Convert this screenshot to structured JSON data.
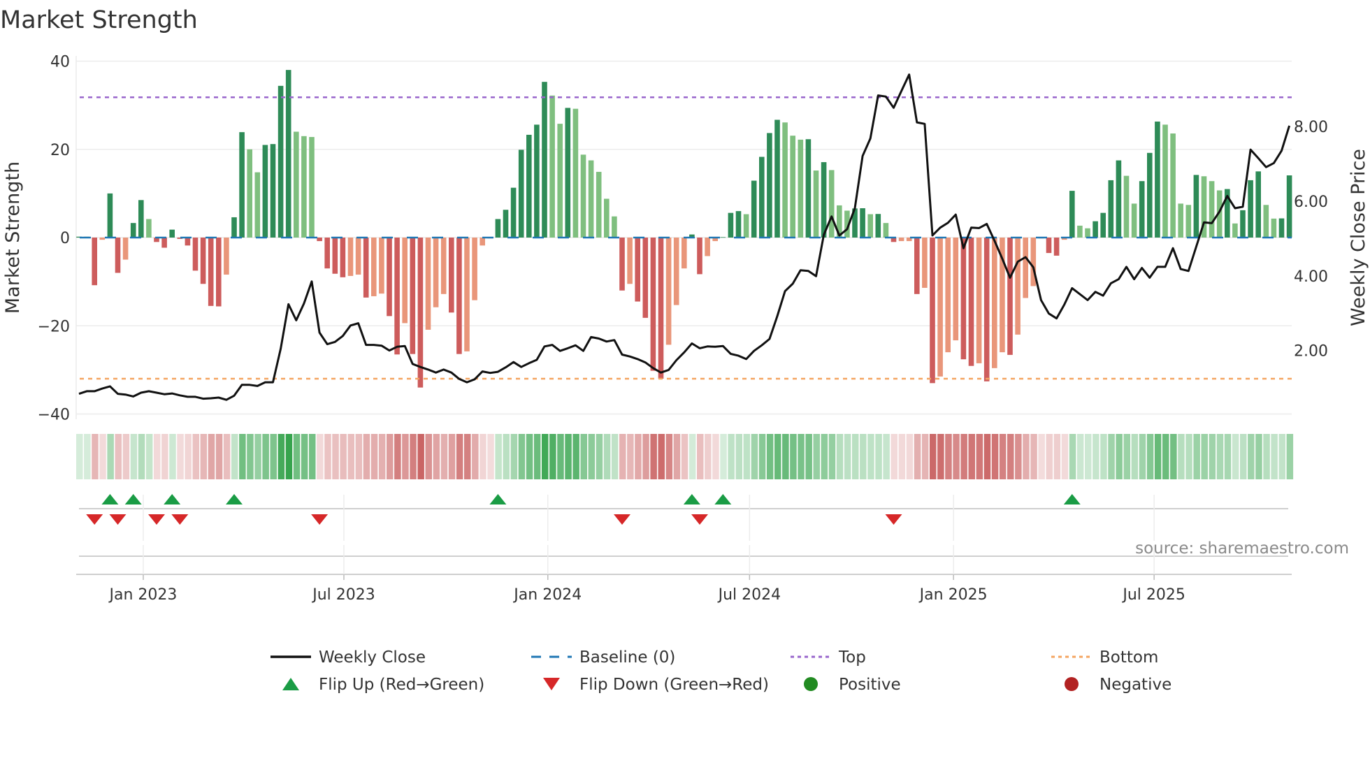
{
  "chart_data": {
    "type": "bar",
    "title": "Market Strength",
    "ylabel": "Market Strength",
    "y2label": "Weekly Close Price",
    "ylim": [
      -40,
      40
    ],
    "y2lim": [
      0.3,
      9.75
    ],
    "yticks": [
      "40",
      "20",
      "0",
      "−20",
      "−40"
    ],
    "ytick_values": [
      40,
      20,
      0,
      -20,
      -40
    ],
    "y2ticks": [
      "8.00",
      "6.00",
      "4.00",
      "2.00"
    ],
    "y2tick_values": [
      8,
      6,
      4,
      2
    ],
    "xticks": [
      {
        "label": "Jan 2023",
        "date": "2023-01-01"
      },
      {
        "label": "Jul 2023",
        "date": "2023-07-01"
      },
      {
        "label": "Jan 2024",
        "date": "2024-01-01"
      },
      {
        "label": "Jul 2024",
        "date": "2024-07-01"
      },
      {
        "label": "Jan 2025",
        "date": "2025-01-01"
      },
      {
        "label": "Jul 2025",
        "date": "2025-07-01"
      }
    ],
    "start_date": "2022-11-04",
    "frequency": "weekly",
    "top_level": 31.8,
    "bottom_level": -32,
    "baseline": 0,
    "strength": [
      0.2,
      0.2,
      -10.8,
      -0.5,
      10,
      -8,
      -5,
      3.3,
      8.5,
      4.2,
      -1,
      -2.3,
      1.8,
      -0.3,
      -1.8,
      -7.5,
      -10.5,
      -15.5,
      -15.6,
      -8.4,
      4.6,
      23.9,
      20,
      14.8,
      21,
      21.2,
      34.4,
      38,
      24,
      23,
      22.8,
      -0.8,
      -7,
      -8.2,
      -9,
      -8.7,
      -8.4,
      -13.6,
      -13.3,
      -12.7,
      -17.8,
      -26.5,
      -19.4,
      -26.4,
      -34,
      -20.9,
      -15.8,
      -12.8,
      -17,
      -26.4,
      -25.8,
      -14.2,
      -1.8,
      -0.2,
      4.2,
      6.3,
      11.3,
      19.9,
      23.3,
      25.6,
      35.3,
      32.2,
      25.8,
      29.4,
      29.2,
      18.8,
      17.5,
      14.9,
      8.8,
      4.8,
      -12,
      -10.5,
      -14.5,
      -18.2,
      -30.2,
      -32,
      -24.3,
      -15.3,
      -7,
      0.7,
      -8.3,
      -4.2,
      -0.8,
      0.1,
      5.6,
      6,
      5.3,
      12.9,
      18.3,
      23.7,
      26.7,
      26.1,
      23.1,
      22.2,
      22.3,
      15.2,
      17.1,
      15.3,
      7.3,
      6.1,
      6.6,
      6.65,
      5.3,
      5.35,
      3.3,
      -1,
      -0.8,
      -0.8,
      -12.8,
      -11.4,
      -33,
      -31.5,
      -26,
      -23.3,
      -27.6,
      -29.1,
      -28.5,
      -32.6,
      -29.6,
      -26,
      -26.6,
      -22,
      -13.7,
      -11,
      -0.2,
      -3.5,
      -4.1,
      -0.5,
      10.6,
      2.7,
      2.1,
      3.7,
      5.6,
      13,
      17.5,
      14,
      7.7,
      12.8,
      19.2,
      26.3,
      25.6,
      23.6,
      7.7,
      7.4,
      14.2,
      13.9,
      12.8,
      10.7,
      11,
      3.2,
      6.2,
      13,
      15,
      7.4,
      4.3,
      4.35,
      14.1
    ],
    "weekly_close": [
      0.84,
      0.91,
      0.91,
      0.98,
      1.04,
      0.84,
      0.82,
      0.77,
      0.87,
      0.91,
      0.87,
      0.83,
      0.85,
      0.8,
      0.76,
      0.76,
      0.71,
      0.72,
      0.74,
      0.68,
      0.79,
      1.08,
      1.08,
      1.05,
      1.15,
      1.15,
      2.05,
      3.24,
      2.81,
      3.26,
      3.85,
      2.48,
      2.17,
      2.23,
      2.39,
      2.67,
      2.73,
      2.15,
      2.15,
      2.13,
      2.0,
      2.1,
      2.12,
      1.64,
      1.56,
      1.49,
      1.41,
      1.49,
      1.41,
      1.24,
      1.15,
      1.23,
      1.44,
      1.4,
      1.43,
      1.55,
      1.69,
      1.56,
      1.66,
      1.75,
      2.11,
      2.15,
      1.99,
      2.06,
      2.14,
      1.99,
      2.36,
      2.32,
      2.24,
      2.28,
      1.89,
      1.84,
      1.77,
      1.68,
      1.53,
      1.41,
      1.48,
      1.74,
      1.95,
      2.19,
      2.06,
      2.11,
      2.1,
      2.12,
      1.91,
      1.86,
      1.77,
      1.99,
      2.14,
      2.31,
      2.92,
      3.59,
      3.79,
      4.15,
      4.13,
      3.99,
      5.1,
      5.59,
      5.08,
      5.25,
      5.81,
      7.21,
      7.68,
      8.83,
      8.8,
      8.5,
      8.95,
      9.39,
      8.11,
      8.07,
      5.08,
      5.29,
      5.42,
      5.64,
      4.74,
      5.29,
      5.28,
      5.39,
      4.94,
      4.46,
      3.95,
      4.38,
      4.5,
      4.23,
      3.35,
      2.99,
      2.86,
      3.23,
      3.67,
      3.51,
      3.35,
      3.57,
      3.47,
      3.8,
      3.91,
      4.24,
      3.91,
      4.21,
      3.95,
      4.24,
      4.24,
      4.74,
      4.18,
      4.13,
      4.78,
      5.43,
      5.41,
      5.72,
      6.14,
      5.81,
      5.85,
      7.38,
      7.15,
      6.91,
      7.02,
      7.35,
      8.02
    ],
    "flip_up_weeks": [
      4,
      7,
      12,
      20,
      54,
      79,
      83,
      128
    ],
    "flip_down_weeks": [
      2,
      5,
      10,
      13,
      31,
      70,
      80,
      105
    ],
    "legend_position": "bottom",
    "legend": [
      {
        "label": "Weekly Close",
        "symbol": "line"
      },
      {
        "label": "Baseline (0)",
        "symbol": "dash"
      },
      {
        "label": "Top",
        "symbol": "dot"
      },
      {
        "label": "Bottom",
        "symbol": "dot"
      },
      {
        "label": "Flip Up (Red→Green)",
        "symbol": "triangle-up"
      },
      {
        "label": "Flip Down (Green→Red)",
        "symbol": "triangle-down"
      },
      {
        "label": "Positive",
        "symbol": "circle"
      },
      {
        "label": "Negative",
        "symbol": "circle"
      }
    ],
    "colors": {
      "pos_strong": "#2e8b57",
      "pos_weak": "#7fbf7f",
      "neg_strong": "#cd5c5c",
      "neg_weak": "#e9967a",
      "line": "#111111",
      "baseline": "#1f77b4",
      "top": "#9966cc",
      "bottom": "#f4a460",
      "flip_up": "#1a9c45",
      "flip_down": "#d62728",
      "positive": "#228b22",
      "negative": "#b22222"
    }
  },
  "source": "source: sharemaestro.com"
}
